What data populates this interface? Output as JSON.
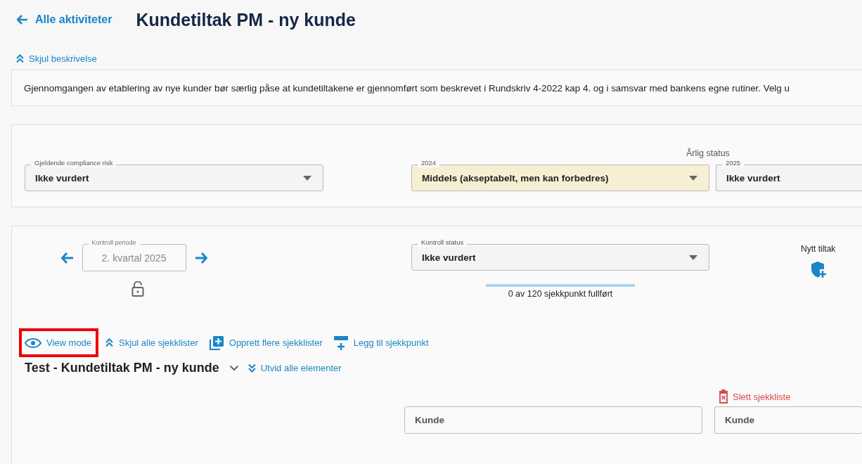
{
  "header": {
    "back_link": "Alle aktiviteter",
    "title": "Kundetiltak PM - ny kunde"
  },
  "description": {
    "toggle": "Skjul beskrivelse",
    "expanded": true,
    "text": "Gjennomgangen av etablering av nye kunder bør særlig påse at kundetiltakene er gjennomført som beskrevet i Rundskriv 4-2022 kap 4. og i samsvar med bankens egne rutiner. Velg u"
  },
  "risk": {
    "compliance": {
      "label": "Gjeldende compliance risk",
      "value": "Ikke vurdert"
    },
    "annual_heading": "Årlig status",
    "annual": [
      {
        "label": "2024",
        "value": "Middels (akseptabelt, men kan forbedres)",
        "color": "#f7efd4"
      },
      {
        "label": "2025",
        "value": "Ikke vurdert",
        "color": "#f4f4f4"
      }
    ]
  },
  "control": {
    "period": {
      "label": "Kontroll periode",
      "value": "2. kvartal 2025",
      "locked": false
    },
    "status": {
      "label": "Kontroll status",
      "value": "Ikke vurdert"
    },
    "progress": {
      "level": 0,
      "text": "0 av 120 sjekkpunkt fullført"
    },
    "new_action": "Nytt tiltak"
  },
  "toolbar": [
    {
      "kind": "eye",
      "label": "View mode",
      "highlighted": true
    },
    {
      "kind": "collapse",
      "label": "Skjul alle sjekklister",
      "highlighted": false
    },
    {
      "kind": "add-copy",
      "label": "Opprett flere sjekklister",
      "highlighted": false
    },
    {
      "kind": "add-row",
      "label": "Legg til sjekkpunkt",
      "highlighted": false
    }
  ],
  "checklist": {
    "title": "Test - Kundetiltak PM - ny kunde",
    "expand_all": "Utvid alle elementer",
    "delete": "Slett sjekkliste",
    "fields": [
      {
        "placeholder": "Kunde"
      },
      {
        "placeholder": "Kunde"
      }
    ]
  }
}
